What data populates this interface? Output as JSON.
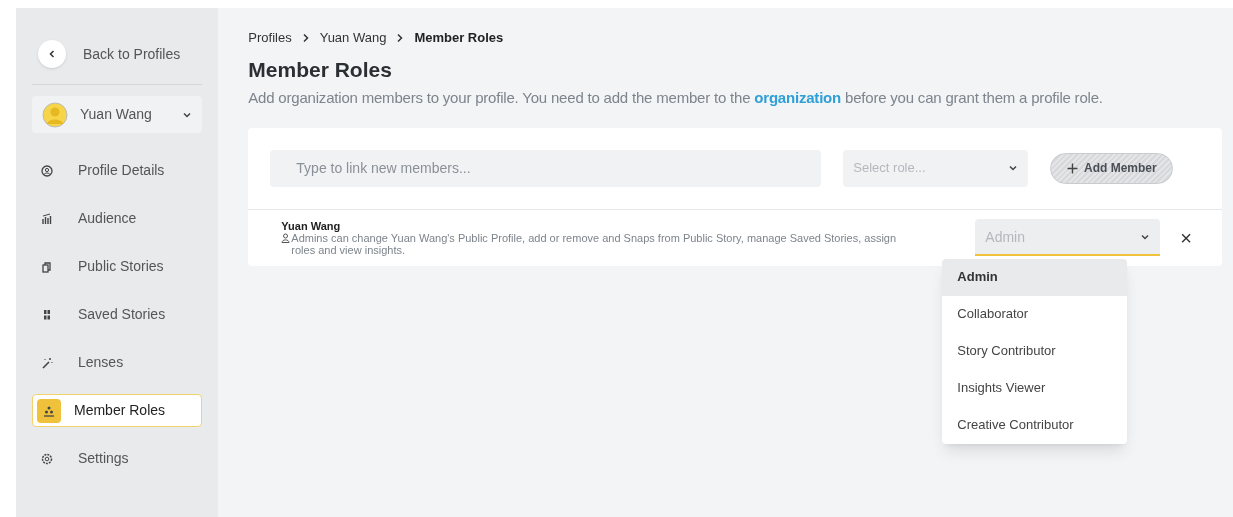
{
  "sidebar": {
    "back": {
      "label": "Back to Profiles"
    },
    "profile": {
      "name": "Yuan Wang"
    },
    "items": [
      {
        "label": "Profile Details",
        "selected": false
      },
      {
        "label": "Audience",
        "selected": false
      },
      {
        "label": "Public Stories",
        "selected": false
      },
      {
        "label": "Saved Stories",
        "selected": false
      },
      {
        "label": "Lenses",
        "selected": false
      },
      {
        "label": "Member Roles",
        "selected": true
      },
      {
        "label": "Settings",
        "selected": false
      }
    ]
  },
  "breadcrumb": [
    {
      "label": "Profiles",
      "current": false
    },
    {
      "label": "Yuan Wang",
      "current": false
    },
    {
      "label": "Member Roles",
      "current": true
    }
  ],
  "title": "Member Roles",
  "subtitle": "Add organization members to your profile. You need to add the member to the **organization** before you can grant them a profile role.",
  "add_form": {
    "search_placeholder": "Type to link new members...",
    "role_placeholder": "Select role...",
    "button": "Add Member"
  },
  "members": [
    {
      "name": "Yuan Wang",
      "description": "Admins can change Yuan Wang's Public Profile, add or remove and Snaps from Public Story, manage Saved Stories, assign roles and view insights.",
      "role_placeholder": "Admin",
      "remove": "×",
      "dropdown": [
        {
          "label": "Admin",
          "selected": true
        },
        {
          "label": "Collaborator",
          "selected": false
        },
        {
          "label": "Story Contributor",
          "selected": false
        },
        {
          "label": "Insights Viewer",
          "selected": false
        },
        {
          "label": "Creative Contributor",
          "selected": false
        }
      ]
    }
  ]
}
